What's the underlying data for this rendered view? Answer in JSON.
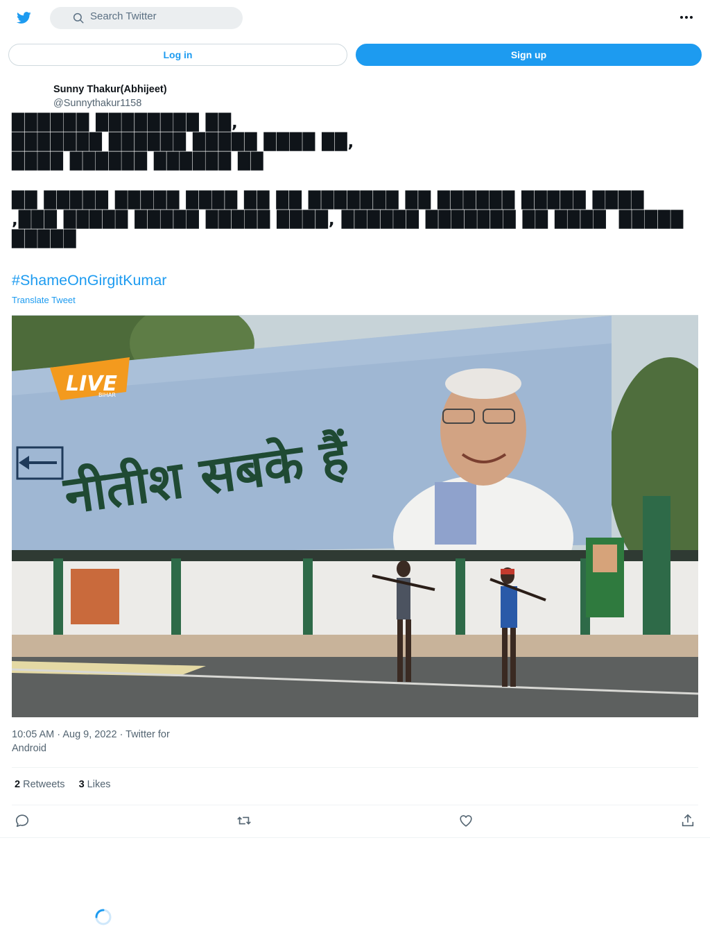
{
  "header": {
    "logo_icon": "twitter-bird-icon",
    "search_placeholder": "Search Twitter",
    "more_icon": "more-horizontal-icon"
  },
  "auth": {
    "login_label": "Log in",
    "signup_label": "Sign up"
  },
  "tweet": {
    "author_name": "Sunny Thakur(Abhijeet)",
    "author_handle": "@Sunnythakur1158",
    "text": "██████ ████████ ██,\n███████ ██████ █████ ████ ██,\n████ ██████ ██████ ██\n\n██ █████ █████ ████ ██ ██ ███████ ██ ██████ █████ ████\n,███ █████ █████ █████ ████, ██████ ███████ ██ ████  █████\n█████",
    "hashtag": "#ShameOnGirgitKumar",
    "translate_label": "Translate Tweet",
    "timestamp_line1": "10:05 AM · Aug 9, 2022 · Twitter for",
    "timestamp_line2": "Android",
    "retweets_count": "2",
    "retweets_label": "Retweets",
    "likes_count": "3",
    "likes_label": "Likes"
  },
  "media": {
    "banner_text": "नीतीश सबके हैं",
    "logo_text": "LIVE",
    "logo_sub": "BIHAR"
  },
  "colors": {
    "accent": "#1d9bf0",
    "text_secondary": "#536471"
  }
}
